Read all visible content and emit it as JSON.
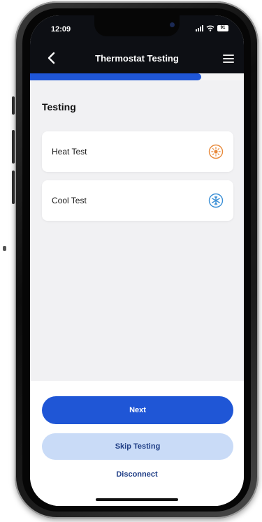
{
  "status_bar": {
    "time": "12:09",
    "battery": "91"
  },
  "header": {
    "title": "Thermostat Testing",
    "back_icon": "chevron-left-icon",
    "menu_icon": "hamburger-menu-icon"
  },
  "progress": {
    "fraction": 0.8,
    "color": "#1f56d6"
  },
  "section": {
    "heading": "Testing"
  },
  "tests": [
    {
      "label": "Heat Test",
      "icon": "heat-icon",
      "color": "#e8893a"
    },
    {
      "label": "Cool Test",
      "icon": "snowflake-icon",
      "color": "#3a8fd6"
    }
  ],
  "footer": {
    "next_label": "Next",
    "skip_label": "Skip Testing",
    "disconnect_label": "Disconnect"
  },
  "colors": {
    "accent": "#1f56d6",
    "accent_light": "#c9dbf7",
    "header_bg": "#0d0f14"
  }
}
